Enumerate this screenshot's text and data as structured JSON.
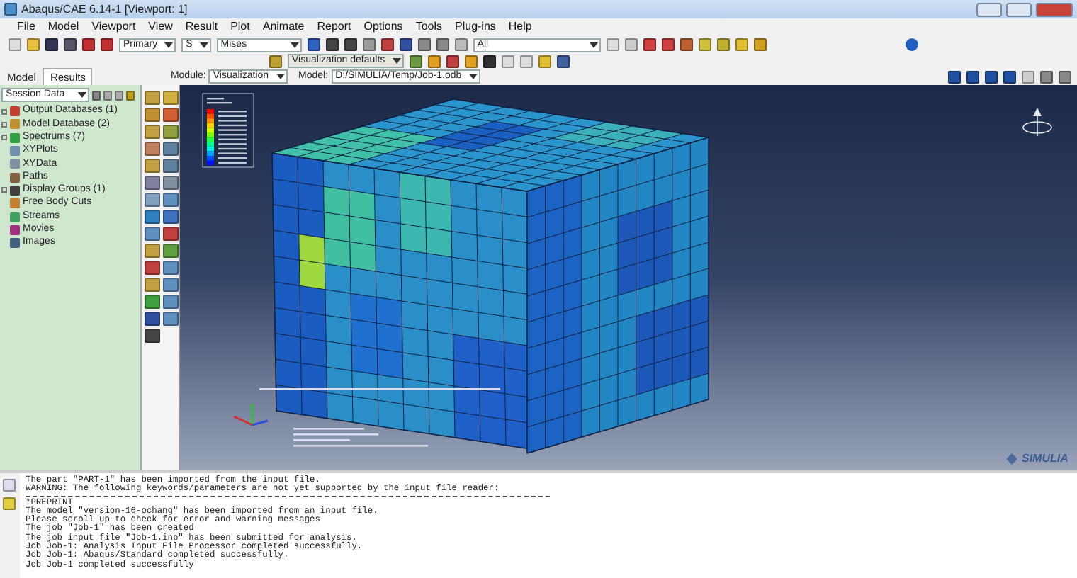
{
  "window": {
    "title": "Abaqus/CAE 6.14-1 [Viewport: 1]"
  },
  "menu": [
    "File",
    "Model",
    "Viewport",
    "View",
    "Result",
    "Plot",
    "Animate",
    "Report",
    "Options",
    "Tools",
    "Plug-ins",
    "Help"
  ],
  "toolbar": {
    "step_option": "Primary",
    "field_variable": "S",
    "invariant": "Mises",
    "selection": "All",
    "defaults": "Visualization defaults"
  },
  "context": {
    "module_label": "Module:",
    "module": "Visualization",
    "model_label": "Model:",
    "model": "D:/SIMULIA/Temp/Job-1.odb"
  },
  "tabs": [
    {
      "label": "Model",
      "selected": false
    },
    {
      "label": "Results",
      "selected": true
    }
  ],
  "tree_filter": "Session Data",
  "tree": [
    {
      "label": "Output Databases (1)",
      "expandable": true,
      "color": "#c04030"
    },
    {
      "label": "Model Database (2)",
      "expandable": true,
      "color": "#c09030"
    },
    {
      "label": "Spectrums (7)",
      "expandable": true,
      "color": "#30a040"
    },
    {
      "label": "XYPlots",
      "expandable": false,
      "color": "#7090b0"
    },
    {
      "label": "XYData",
      "expandable": false,
      "color": "#8090a0"
    },
    {
      "label": "Paths",
      "expandable": false,
      "color": "#806040"
    },
    {
      "label": "Display Groups (1)",
      "expandable": true,
      "color": "#404040"
    },
    {
      "label": "Free Body Cuts",
      "expandable": false,
      "color": "#c08030"
    },
    {
      "label": "Streams",
      "expandable": false,
      "color": "#40a060"
    },
    {
      "label": "Movies",
      "expandable": false,
      "color": "#a03080"
    },
    {
      "label": "Images",
      "expandable": false,
      "color": "#406080"
    }
  ],
  "logo": "SIMULIA",
  "messages": [
    {
      "kind": "text",
      "text": "The part \"PART-1\" has been imported from the input file."
    },
    {
      "kind": "text",
      "text": "WARNING: The following keywords/parameters are not yet supported by the input file reader:"
    },
    {
      "kind": "rule"
    },
    {
      "kind": "text",
      "text": "*PREPRINT"
    },
    {
      "kind": "text",
      "text": "The model \"version-16-ochang\" has been imported from an input file."
    },
    {
      "kind": "text",
      "text": "Please scroll up to check for error and warning messages"
    },
    {
      "kind": "text",
      "text": "The job \"Job-1\" has been created"
    },
    {
      "kind": "text",
      "text": "The job input file \"Job-1.inp\" has been submitted for analysis."
    },
    {
      "kind": "text",
      "text": "Job Job-1: Analysis Input File Processor completed successfully."
    },
    {
      "kind": "text",
      "text": "Job Job-1: Abaqus/Standard completed successfully."
    },
    {
      "kind": "text",
      "text": "Job Job-1 completed successfully"
    }
  ]
}
